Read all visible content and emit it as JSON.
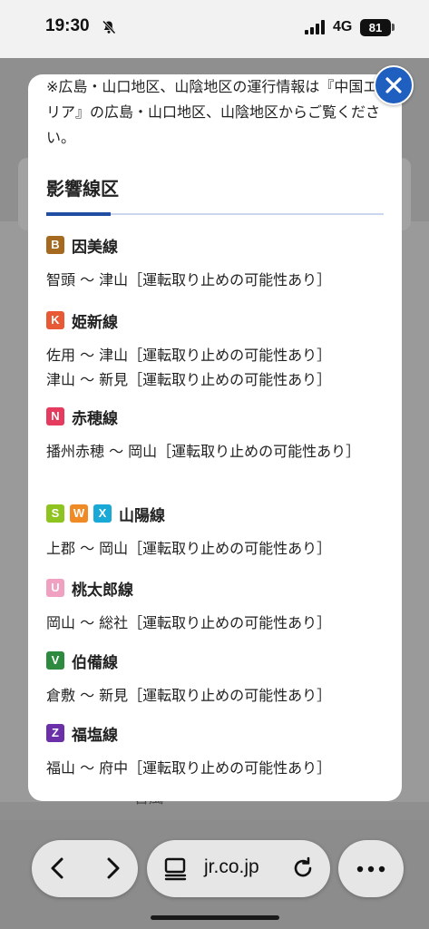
{
  "status_bar": {
    "time": "19:30",
    "network": "4G",
    "battery": "81"
  },
  "modal": {
    "intro_text": "※広島・山口地区、山陰地区の運行情報は『中国エリア』の広島・山口地区、山陰地区からご覧ください。",
    "section_title": "影響線区",
    "lines": [
      {
        "name": "因美線",
        "badges": [
          {
            "letter": "B",
            "color": "#a5691f"
          }
        ],
        "sections": [
          "智頭 〜 津山［運転取り止めの可能性あり］"
        ]
      },
      {
        "name": "姫新線",
        "badges": [
          {
            "letter": "K",
            "color": "#e85a35"
          }
        ],
        "sections": [
          "佐用 〜 津山［運転取り止めの可能性あり］",
          "津山 〜 新見［運転取り止めの可能性あり］"
        ]
      },
      {
        "name": "赤穂線",
        "badges": [
          {
            "letter": "N",
            "color": "#e43b5e"
          }
        ],
        "sections": [
          "播州赤穂 〜 岡山［運転取り止めの可能性あり］"
        ]
      },
      {
        "name": "山陽線",
        "badges": [
          {
            "letter": "S",
            "color": "#8fc31f"
          },
          {
            "letter": "W",
            "color": "#f08a24"
          },
          {
            "letter": "X",
            "color": "#19a9d6"
          }
        ],
        "sections": [
          "上郡 〜 岡山［運転取り止めの可能性あり］"
        ]
      },
      {
        "name": "桃太郎線",
        "badges": [
          {
            "letter": "U",
            "color": "#f0a0c0"
          }
        ],
        "sections": [
          "岡山 〜 総社［運転取り止めの可能性あり］"
        ]
      },
      {
        "name": "伯備線",
        "badges": [
          {
            "letter": "V",
            "color": "#2e8a3e"
          }
        ],
        "sections": [
          "倉敷 〜 新見［運転取り止めの可能性あり］"
        ]
      },
      {
        "name": "福塩線",
        "badges": [
          {
            "letter": "Z",
            "color": "#6b2fa8"
          }
        ],
        "sections": [
          "福山 〜 府中［運転取り止めの可能性あり］"
        ]
      }
    ]
  },
  "background": {
    "partial_text": "台風"
  },
  "toolbar": {
    "url": "jr.co.jp"
  },
  "icons": [
    "bell-slash-icon",
    "signal-icon",
    "close-icon",
    "back-icon",
    "forward-icon",
    "reader-icon",
    "reload-icon",
    "more-icon"
  ]
}
